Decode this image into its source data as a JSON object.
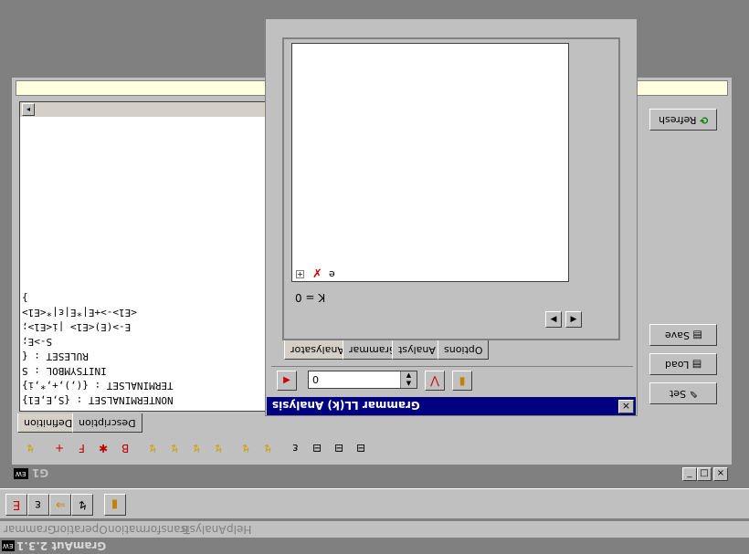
{
  "app": {
    "title": "GramAut 2.3.1",
    "icon": "EW"
  },
  "menu": [
    "Grammar",
    "Operation",
    "Transformation",
    "Analysis",
    "Help"
  ],
  "main_toolbar": [
    "E",
    "ε",
    "⇒",
    "↯",
    "▮"
  ],
  "window_g1": {
    "title": "G1",
    "icon": "EW",
    "controls": [
      "_",
      "□",
      "×"
    ],
    "editor_lines": [
      "NONTERMINALSET : {S,E,E1}",
      "TERMINALSET : {(,),+,*,i}",
      "INITSYMBOL : S",
      "RULESET : {",
      "S->E;",
      "E->(E)<E1> |i<E1>;",
      "<E1>->+E|*E|ε|*<E1>",
      "}"
    ],
    "tabs": [
      "Definition",
      "Description"
    ],
    "side_buttons": {
      "refresh": "Refresh",
      "save": "Save",
      "load": "Load",
      "set": "Set"
    },
    "toolbar_glyphs": [
      "↯",
      "+",
      "F",
      "✱",
      "B",
      "↯",
      "↯",
      "↯",
      "↯",
      "↯",
      "↯",
      "ε",
      "⊟",
      "⊟",
      "⊟"
    ]
  },
  "dialog": {
    "title": "Grammar LL(k) Analysis",
    "close": "×",
    "tree_item": "e",
    "k_label": "K =",
    "k_value": "0",
    "tabs": [
      "Analysator",
      "Grammar",
      "Analyst",
      "Options"
    ],
    "input_value": "0"
  },
  "colors": {
    "dialog_title": "#000080",
    "inactive_title": "#808080",
    "editor_bg": "#ffffff",
    "yellow_bar": "#ffffe0"
  }
}
